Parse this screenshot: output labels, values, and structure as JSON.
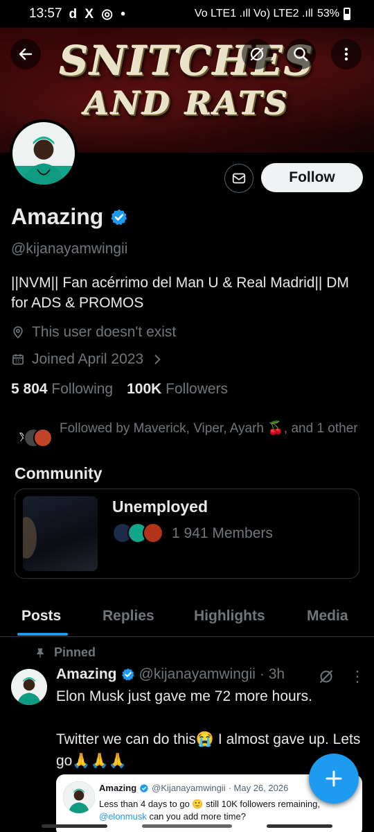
{
  "status_bar": {
    "time": "13:57",
    "left_icons": "d X ◎ •",
    "network": "Vo LTE1 .ıll Vo) LTE2 .ıll",
    "battery": "53%"
  },
  "banner": {
    "line1": "SNITCHES",
    "line2": "AND RATS"
  },
  "profile": {
    "name": "Amazing",
    "handle": "@kijanayamwingii",
    "bio": "||NVM|| Fan acérrimo del Man U & Real Madrid|| DM for ADS & PROMOS",
    "location": "This user doesn't exist",
    "joined": "Joined April 2023",
    "following_count": "5 804",
    "following_label": "Following",
    "followers_count": "100K",
    "followers_label": "Followers",
    "followed_by": "Followed by Maverick, Viper, Ayarh 🍒, and 1 other",
    "follow_button": "Follow"
  },
  "community": {
    "section_title": "Community",
    "name": "Unemployed",
    "members": "1 941 Members"
  },
  "tabs": [
    "Posts",
    "Replies",
    "Highlights",
    "Media"
  ],
  "post": {
    "pinned_label": "Pinned",
    "author_name": "Amazing",
    "author_handle": "@kijanayamwingii",
    "time": "· 3h",
    "text": "Elon Musk just gave me 72 more hours.\n\nTwitter we can do this😭 I almost gave up. Lets go🙏🙏🙏",
    "quoted": {
      "name": "Amazing",
      "handle": "@Kijanayamwingii",
      "date": "· May 26, 2026",
      "text_line1": "Less than 4 days to go 🙂 still 10K followers remaining,",
      "mention": "@elonmusk",
      "text_line2": " can you add more time?"
    }
  },
  "colors": {
    "accent": "#1d9bf0",
    "background": "#000000",
    "secondary_text": "#71767b"
  }
}
